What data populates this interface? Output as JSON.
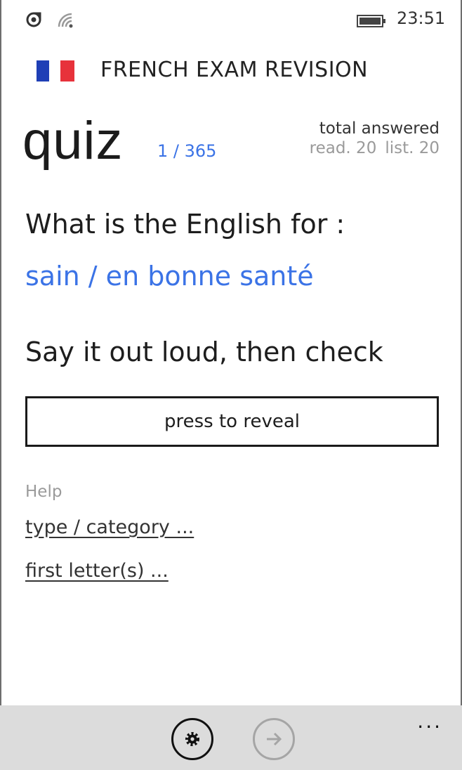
{
  "status_bar": {
    "time": "23:51",
    "icons": [
      "signal-icon",
      "wifi-icon",
      "battery-icon"
    ]
  },
  "header": {
    "flag": "french-flag",
    "title": "FRENCH EXAM REVISION"
  },
  "quiz": {
    "title": "quiz",
    "progress": "1 / 365",
    "stats_label": "total answered",
    "reading": "read. 20",
    "listening": "list. 20"
  },
  "question": {
    "prompt": "What is the English for :",
    "word": "sain / en bonne santé",
    "instruction": "Say it out loud, then check",
    "reveal_button": "press to reveal"
  },
  "help": {
    "label": "Help",
    "links": [
      "type / category ...",
      "first letter(s) ..."
    ]
  },
  "app_bar": {
    "buttons": [
      "settings-icon",
      "arrow-right-icon"
    ],
    "more": "..."
  },
  "colors": {
    "accent": "#3b73e6",
    "flag_blue": "#1f3fb6",
    "flag_red": "#e7323b",
    "app_bar": "#dcdcdc"
  }
}
